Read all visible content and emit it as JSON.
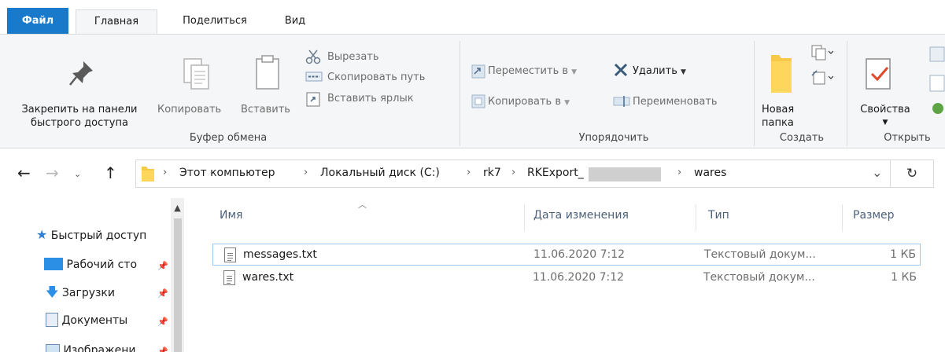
{
  "ribbon_tabs": {
    "file": "Файл",
    "home": "Главная",
    "share": "Поделиться",
    "view": "Вид"
  },
  "clipboard": {
    "pin_line1": "Закрепить на панели",
    "pin_line2": "быстрого доступа",
    "copy": "Копировать",
    "paste": "Вставить",
    "cut": "Вырезать",
    "copy_path": "Скопировать путь",
    "paste_shortcut": "Вставить ярлык",
    "group_label": "Буфер обмена"
  },
  "organize": {
    "move_to": "Переместить в",
    "copy_to": "Копировать в",
    "delete": "Удалить",
    "rename": "Переименовать",
    "group_label": "Упорядочить"
  },
  "create": {
    "new_folder_line1": "Новая",
    "new_folder_line2": "папка",
    "group_label": "Создать"
  },
  "open": {
    "properties": "Свойства",
    "group_label": "Открыть"
  },
  "address": {
    "crumbs": [
      "Этот компьютер",
      "Локальный диск (C:)",
      "rk7",
      "RKExport_",
      "wares"
    ]
  },
  "nav_pane": {
    "items": [
      {
        "label": "Быстрый доступ",
        "icon": "star-icon"
      },
      {
        "label": "Рабочий сто",
        "icon": "desktop-icon"
      },
      {
        "label": "Загрузки",
        "icon": "download-icon"
      },
      {
        "label": "Документы",
        "icon": "documents-icon"
      },
      {
        "label": "Изображени",
        "icon": "pictures-icon"
      }
    ]
  },
  "file_list": {
    "columns": [
      "Имя",
      "Дата изменения",
      "Тип",
      "Размер"
    ],
    "rows": [
      {
        "name": "messages.txt",
        "date": "11.06.2020 7:12",
        "type": "Текстовый докум...",
        "size": "1 КБ"
      },
      {
        "name": "wares.txt",
        "date": "11.06.2020 7:12",
        "type": "Текстовый докум...",
        "size": "1 КБ"
      }
    ]
  },
  "colors": {
    "file_tab": "#1979ca",
    "ribbon_bg": "#f5f6f7",
    "selection_border": "#99c9ef",
    "folder": "#f7c948"
  }
}
